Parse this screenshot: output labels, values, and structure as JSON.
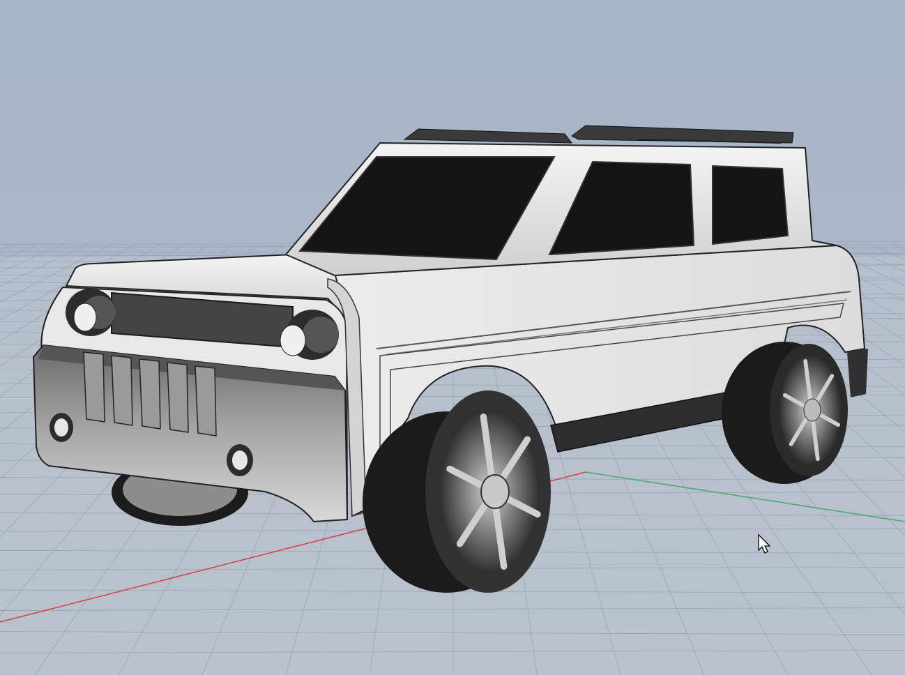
{
  "viewport": {
    "background_color": "#a9b6c7",
    "grid_color": "#98a5b6",
    "x_axis_color": "#d63c3c",
    "y_axis_color": "#4aa86a",
    "body_color": "#e6e6e6",
    "glass_color": "#141414",
    "trim_color": "#2a2a2a",
    "tire_color": "#3a3a3a",
    "cursor_icon": "arrow-cursor-icon"
  }
}
